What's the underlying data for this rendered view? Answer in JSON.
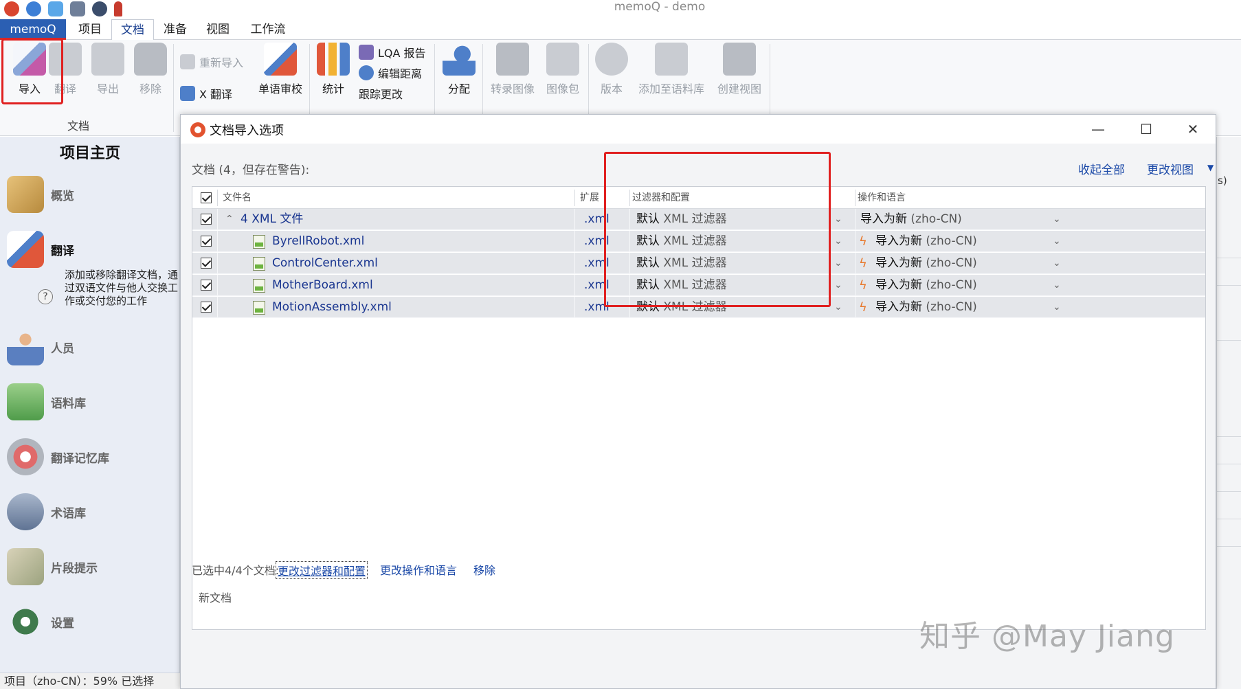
{
  "app": {
    "title": "memoQ - demo"
  },
  "menu": {
    "tabs": [
      {
        "label": "memoQ"
      },
      {
        "label": "项目"
      },
      {
        "label": "文档"
      },
      {
        "label": "准备"
      },
      {
        "label": "视图"
      },
      {
        "label": "工作流"
      }
    ]
  },
  "ribbon": {
    "import": "导入",
    "translate": "翻译",
    "export": "导出",
    "remove": "移除",
    "reimport": "重新导入",
    "x_translate": "X 翻译",
    "monolingual_review": "单语审校",
    "statistics": "统计",
    "lqa_report": "LQA 报告",
    "edit_distance": "编辑距离",
    "track_changes": "跟踪更改",
    "assign": "分配",
    "transcribe_image": "转录图像",
    "image_pack": "图像包",
    "version": "版本",
    "add_to_corpus": "添加至语料库",
    "create_view": "创建视图",
    "group_doc": "文档"
  },
  "left_panel": {
    "title": "项目主页",
    "items": [
      {
        "label": "概览",
        "icon": "box-icon"
      },
      {
        "label": "翻译",
        "icon": "documents-icon"
      },
      {
        "label": "人员",
        "icon": "people-icon"
      },
      {
        "label": "语料库",
        "icon": "cabinet-icon"
      },
      {
        "label": "翻译记忆库",
        "icon": "memory-icon"
      },
      {
        "label": "术语库",
        "icon": "termbase-icon"
      },
      {
        "label": "片段提示",
        "icon": "snippet-icon"
      },
      {
        "label": "设置",
        "icon": "gear-icon"
      }
    ],
    "description_lines": [
      "添加或移除翻译文档，通",
      "过双语文件与他人交换工",
      "作或交付您的工作"
    ],
    "help": "?"
  },
  "status_bar": {
    "text": "项目（zho-CN）：59%  已选择"
  },
  "bg_panel": {
    "fragment": "s)"
  },
  "dialog": {
    "title": "文档导入选项",
    "min": "—",
    "max": "☐",
    "close": "✕",
    "doc_count": "文档 (4，但存在警告):",
    "collapse_all": "收起全部",
    "change_view": "更改视图",
    "columns": {
      "filename": "文件名",
      "ext": "扩展",
      "filter": "过滤器和配置",
      "op": "操作和语言"
    },
    "group_row": {
      "name": "4 XML 文件",
      "ext": ".xml",
      "filter_main": "默认",
      "filter_rest": " XML 过滤器",
      "op_main": "导入为新",
      "op_rest": " (zho-CN)"
    },
    "files": [
      {
        "name": "ByrellRobot.xml",
        "ext": ".xml",
        "filter_main": "默认",
        "filter_rest": " XML 过滤器",
        "op_main": "导入为新",
        "op_rest": " (zho-CN)"
      },
      {
        "name": "ControlCenter.xml",
        "ext": ".xml",
        "filter_main": "默认",
        "filter_rest": " XML 过滤器",
        "op_main": "导入为新",
        "op_rest": " (zho-CN)"
      },
      {
        "name": "MotherBoard.xml",
        "ext": ".xml",
        "filter_main": "默认",
        "filter_rest": " XML 过滤器",
        "op_main": "导入为新",
        "op_rest": " (zho-CN)"
      },
      {
        "name": "MotionAssembly.xml",
        "ext": ".xml",
        "filter_main": "默认",
        "filter_rest": " XML 过滤器",
        "op_main": "导入为新",
        "op_rest": " (zho-CN)"
      }
    ],
    "footer": {
      "selected": "已选中4/4个文档:",
      "change_filter": "更改过滤器和配置",
      "change_op": "更改操作和语言",
      "remove": "移除",
      "new_doc": "新文档"
    }
  },
  "watermark": "知乎 @May Jiang",
  "colors": {
    "accent_blue": "#2b5fb3",
    "link_blue": "#1c4aa8",
    "highlight_red": "#e02020",
    "row_gray": "#e4e6ea",
    "warning_orange": "#e8782b"
  }
}
